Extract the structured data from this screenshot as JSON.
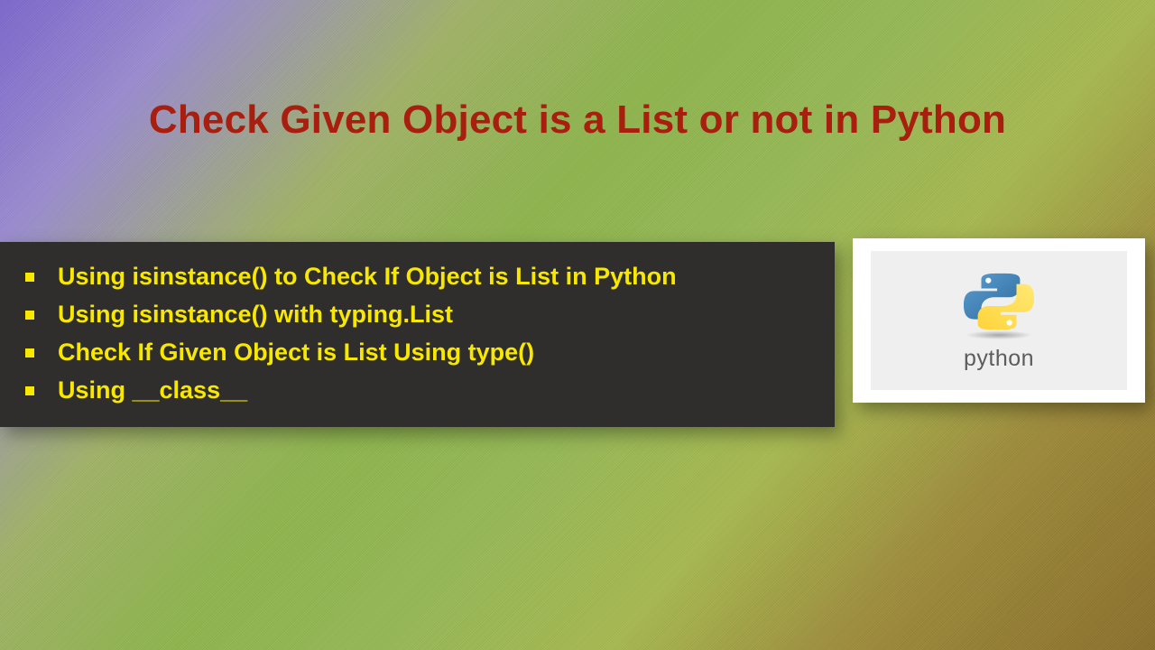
{
  "title": "Check Given Object is a List or not in Python",
  "bullets": [
    "Using isinstance() to Check If Object is List in Python",
    "Using isinstance() with typing.List",
    "Check If Given Object is List Using type()",
    "Using __class__"
  ],
  "logo_caption": "python"
}
